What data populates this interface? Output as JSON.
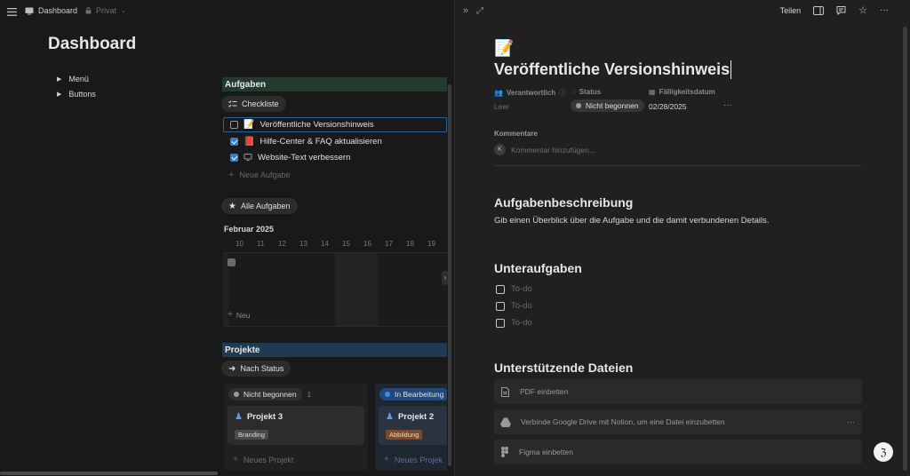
{
  "topbar": {
    "breadcrumb_page": "Dashboard",
    "breadcrumb_space": "Privat",
    "share_label": "Teilen"
  },
  "left": {
    "page_title": "Dashboard",
    "toggles": [
      {
        "label": "Menü"
      },
      {
        "label": "Buttons"
      }
    ],
    "tasks": {
      "header": "Aufgaben",
      "view_label": "Checkliste",
      "items": [
        {
          "title": "Veröffentliche Versionshinweis",
          "checked": false
        },
        {
          "title": "Hilfe-Center & FAQ aktualisieren",
          "checked": true
        },
        {
          "title": "Website-Text verbessern",
          "checked": true
        }
      ],
      "new_task": "Neue Aufgabe"
    },
    "calendar": {
      "view_label": "Alle Aufgaben",
      "month": "Februar 2025",
      "days": [
        "10",
        "11",
        "12",
        "13",
        "14",
        "15",
        "16",
        "17",
        "18",
        "19"
      ],
      "new_label": "Neu"
    },
    "projects": {
      "header": "Projekte",
      "view_label": "Nach Status",
      "columns": [
        {
          "status": "Nicht begonnen",
          "count": "1",
          "card_title": "Projekt 3",
          "card_tag": "Branding",
          "new_label": "Neues Projekt",
          "dot_color": "#9b9b9b",
          "tag_color": "#4a4a4a"
        },
        {
          "status": "In Bearbeitung",
          "count": "",
          "card_title": "Projekt 2",
          "card_tag": "Abbildung",
          "new_label": "Neues Projek",
          "dot_color": "#2f7fd8",
          "tag_color": "#7a4a2a"
        }
      ]
    }
  },
  "right": {
    "title": "Veröffentliche Versionshinweis",
    "props": {
      "owner_label": "Verantwortlich",
      "owner_value": "Leer",
      "status_label": "Status",
      "status_value": "Nicht begonnen",
      "due_label": "Fälligkeitsdatum",
      "due_value": "02/28/2025"
    },
    "comments": {
      "label": "Kommentare",
      "avatar": "K",
      "placeholder": "Kommentar hinzufügen..."
    },
    "description": {
      "heading": "Aufgabenbeschreibung",
      "text": "Gib einen Überblick über die Aufgabe und die damit verbundenen Details."
    },
    "subtasks": {
      "heading": "Unteraufgaben",
      "items": [
        "To-do",
        "To-do",
        "To-do"
      ]
    },
    "files": {
      "heading": "Unterstützende Dateien",
      "items": [
        {
          "label": "PDF einbetten",
          "icon": "pdf-icon"
        },
        {
          "label": "Verbinde Google Drive mit Notion, um eine Datei einzubetten",
          "icon": "google-drive-icon"
        },
        {
          "label": "Figma einbetten",
          "icon": "figma-icon"
        }
      ]
    }
  }
}
